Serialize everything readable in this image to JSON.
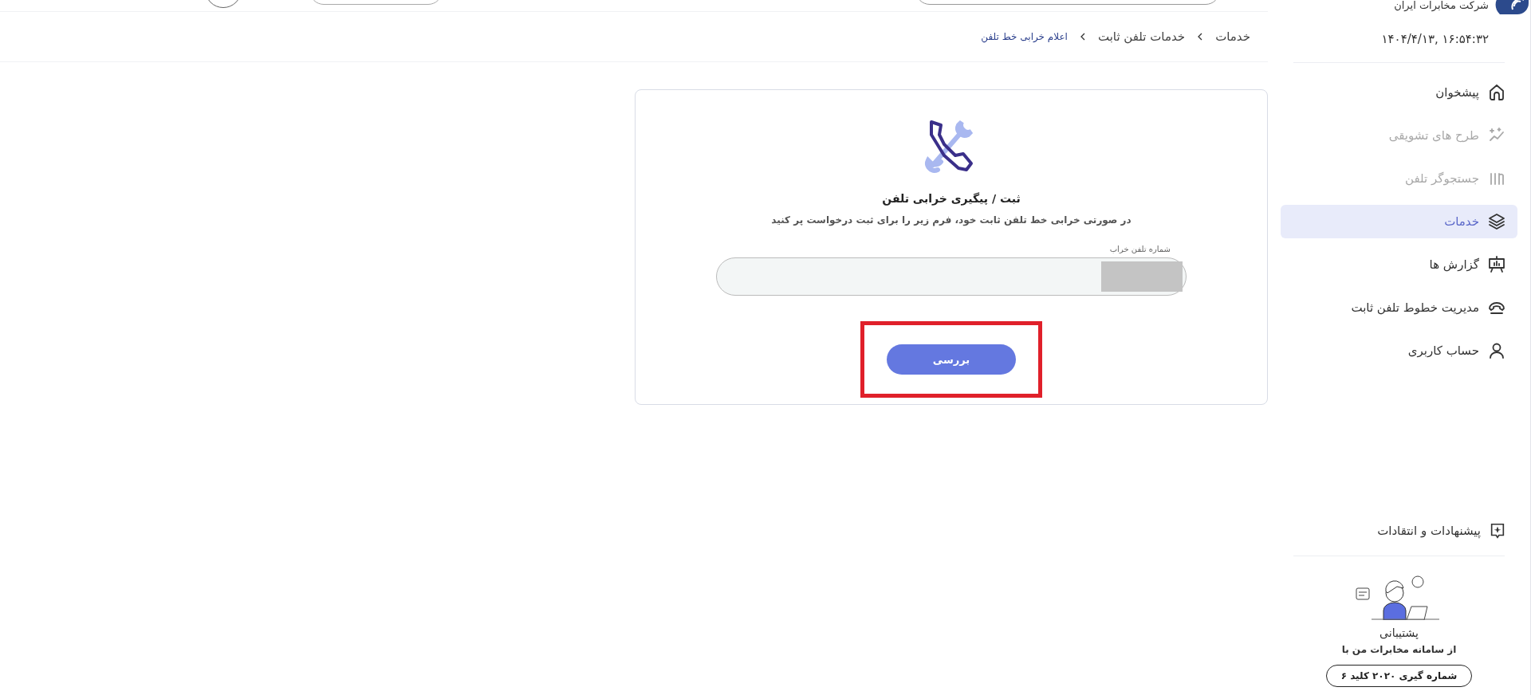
{
  "sidebar": {
    "company": "شرکت مخابرات ایران",
    "datetime": "۱۶:۵۴:۳۲ ,۱۴۰۴/۴/۱۳",
    "items": [
      {
        "label": "پیشخوان",
        "selected": false,
        "disabled": false
      },
      {
        "label": "طرح های تشویقی",
        "selected": false,
        "disabled": true
      },
      {
        "label": "جستجوگر تلفن",
        "selected": false,
        "disabled": true
      },
      {
        "label": "خدمات",
        "selected": true,
        "disabled": false
      },
      {
        "label": "گزارش ها",
        "selected": false,
        "disabled": false
      },
      {
        "label": "مدیریت خطوط تلفن ثابت",
        "selected": false,
        "disabled": false
      },
      {
        "label": "حساب کاربری",
        "selected": false,
        "disabled": false
      }
    ],
    "feedback": "پیشنهادات و انتقادات",
    "support": {
      "title": "پشتیبانی",
      "subtitle": "از سامانه مخابرات من با",
      "button": "شماره گیری ۲۰۲۰ کلید ۶"
    }
  },
  "breadcrumb": [
    {
      "label": "خدمات",
      "current": false
    },
    {
      "label": "خدمات تلفن ثابت",
      "current": false
    },
    {
      "label": "اعلام خرابی خط تلفن",
      "current": true
    }
  ],
  "card": {
    "title": "ثبت / پیگیری خرابی تلفن",
    "description": "در صورتی خرابی خط تلفن ثابت خود، فرم زیر را برای ثبت درخواست پر کنید",
    "field_label": "شماره تلفن خراب",
    "redacted": true,
    "button": {
      "label": "بررسی",
      "highlighted": true
    }
  }
}
